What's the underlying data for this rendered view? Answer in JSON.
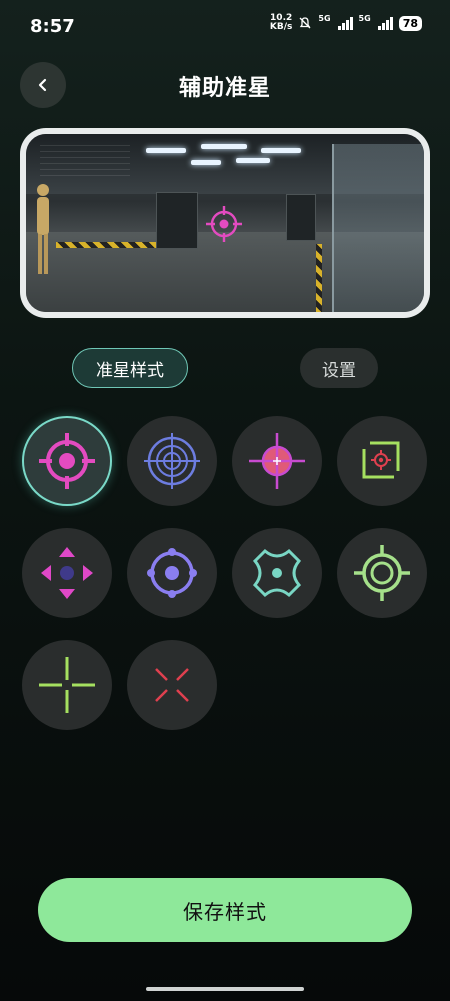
{
  "status_bar": {
    "time": "8:57",
    "net_speed_value": "10.2",
    "net_speed_unit": "KB/s",
    "signal_1_label": "5G",
    "signal_2_label": "5G",
    "battery": "78"
  },
  "header": {
    "title": "辅助准星",
    "back_icon": "chevron-left-icon"
  },
  "tabs": [
    {
      "label": "准星样式",
      "active": true
    },
    {
      "label": "设置",
      "active": false
    }
  ],
  "crosshair_styles": [
    {
      "icon": "crosshair-dot-ring-pink",
      "color": "#e34bc0",
      "selected": true
    },
    {
      "icon": "crosshair-radar-blue",
      "color": "#6d7de0",
      "selected": false
    },
    {
      "icon": "crosshair-circle-magenta",
      "color": "#d84fc8",
      "selected": false
    },
    {
      "icon": "crosshair-square-red",
      "color": "#e0404f",
      "selected": false
    },
    {
      "icon": "crosshair-arrows-dot",
      "color": "#e048c8",
      "selected": false
    },
    {
      "icon": "crosshair-circle-purple",
      "color": "#8a7ef0",
      "selected": false
    },
    {
      "icon": "crosshair-clover-teal",
      "color": "#79d6c4",
      "selected": false
    },
    {
      "icon": "crosshair-double-ring-green",
      "color": "#a5e08a",
      "selected": false
    },
    {
      "icon": "crosshair-plus-green",
      "color": "#a5e060",
      "selected": false
    },
    {
      "icon": "crosshair-x-red",
      "color": "#e0404f",
      "selected": false
    }
  ],
  "save_button": {
    "label": "保存样式"
  }
}
